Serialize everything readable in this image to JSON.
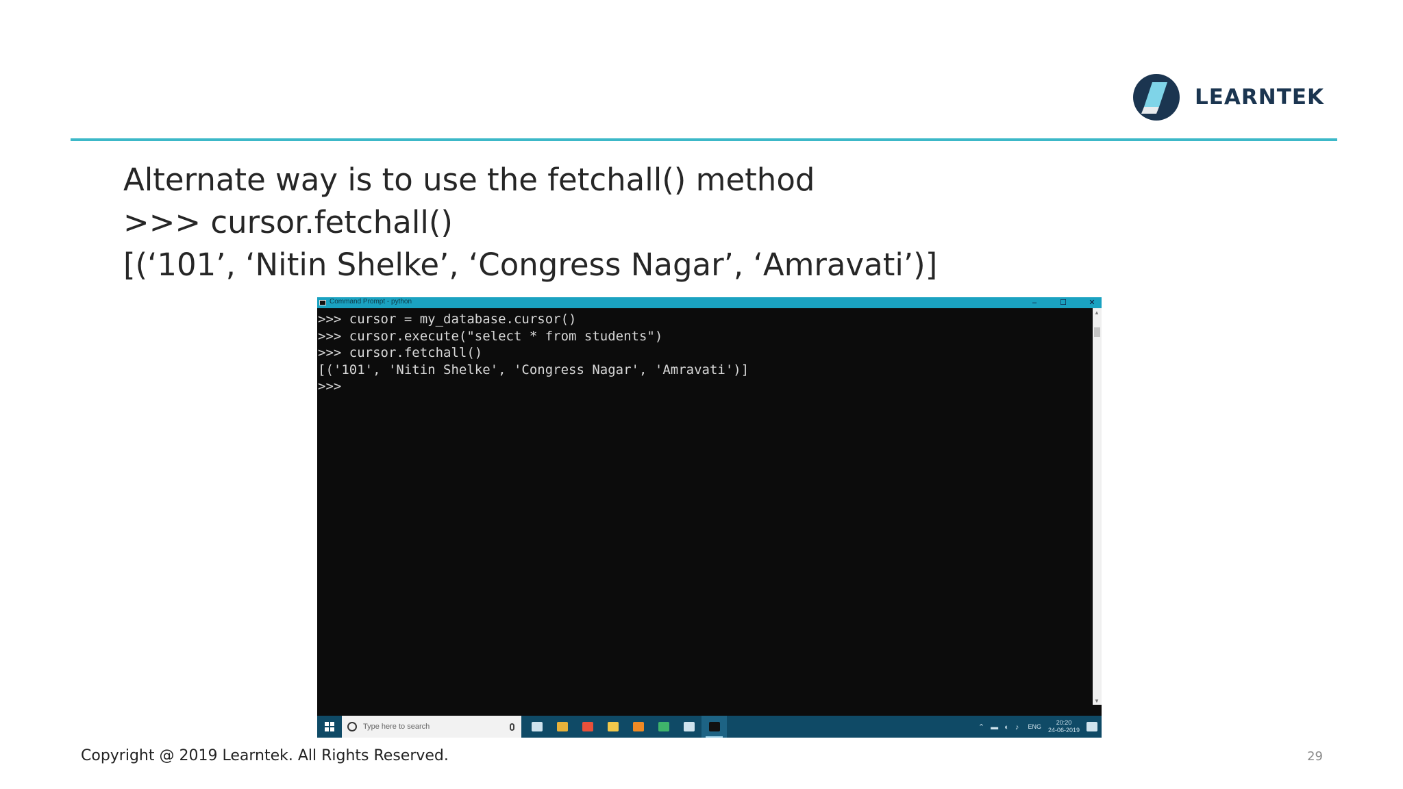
{
  "brand": {
    "name": "LEARNTEK",
    "colors": {
      "navy": "#1b3550",
      "teal": "#3cb8c8",
      "light_blue": "#7fd4e8"
    }
  },
  "slide": {
    "lines": [
      "Alternate way is to use the fetchall() method",
      ">>> cursor.fetchall()",
      "[(‘101’, ‘Nitin Shelke’, ‘Congress Nagar’, ‘Amravati’)]"
    ],
    "footer": "Copyright @ 2019 Learntek. All Rights Reserved.",
    "page_number": "29"
  },
  "terminal": {
    "title": "Command Prompt - python",
    "controls": {
      "minimize": "–",
      "maximize": "☐",
      "close": "✕"
    },
    "lines": [
      ">>> cursor = my_database.cursor()",
      ">>> cursor.execute(\"select * from students\")",
      ">>> cursor.fetchall()",
      "[('101', 'Nitin Shelke', 'Congress Nagar', 'Amravati')]",
      ">>>"
    ],
    "colors": {
      "background": "#0c0c0c",
      "text": "#d8d8d8",
      "titlebar": "#1aa2c1"
    }
  },
  "taskbar": {
    "search_placeholder": "Type here to search",
    "apps": [
      {
        "name": "task-view-icon",
        "color": "#cfe3ee"
      },
      {
        "name": "chrome-icon",
        "color": "#e8b23a"
      },
      {
        "name": "app-icon",
        "color": "#e8503a"
      },
      {
        "name": "file-explorer-icon",
        "color": "#f1c84b"
      },
      {
        "name": "vlc-icon",
        "color": "#f08a24"
      },
      {
        "name": "pycharm-icon",
        "color": "#3fb46b"
      },
      {
        "name": "store-icon",
        "color": "#cfe3ee"
      },
      {
        "name": "command-prompt-icon",
        "color": "#111111"
      }
    ],
    "tray": {
      "language": "ENG",
      "time": "20:20",
      "date": "24-06-2019"
    },
    "color": "#0f4a66"
  }
}
